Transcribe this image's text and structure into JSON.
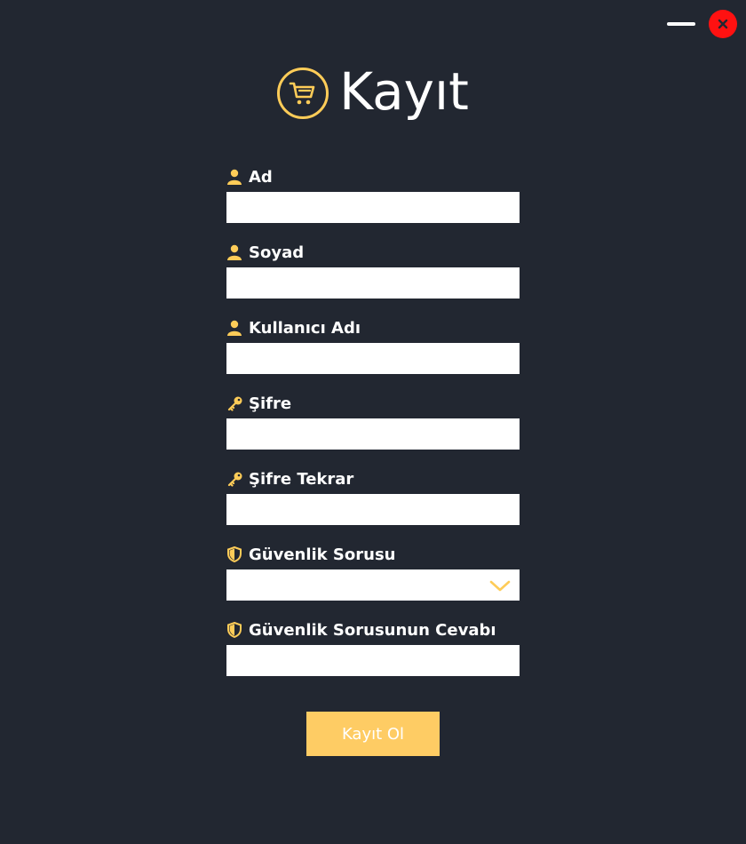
{
  "window": {
    "controls": {
      "minimize_icon": "minimize-icon",
      "close_icon": "close-icon"
    },
    "colors": {
      "background": "#222731",
      "accent": "#fecc58",
      "close": "#ff1111"
    }
  },
  "header": {
    "title": "Kayıt",
    "logo_icon": "shopping-cart-icon"
  },
  "form": {
    "first_name": {
      "label": "Ad",
      "icon": "user-icon",
      "value": ""
    },
    "last_name": {
      "label": "Soyad",
      "icon": "user-icon",
      "value": ""
    },
    "username": {
      "label": "Kullanıcı Adı",
      "icon": "user-icon",
      "value": ""
    },
    "password": {
      "label": "Şifre",
      "icon": "key-icon",
      "value": ""
    },
    "password_repeat": {
      "label": "Şifre Tekrar",
      "icon": "key-icon",
      "value": ""
    },
    "security_question": {
      "label": "Güvenlik Sorusu",
      "icon": "shield-icon",
      "selected": ""
    },
    "security_answer": {
      "label": "Güvenlik Sorusunun Cevabı",
      "icon": "shield-icon",
      "value": ""
    }
  },
  "submit": {
    "label": "Kayıt Ol"
  }
}
